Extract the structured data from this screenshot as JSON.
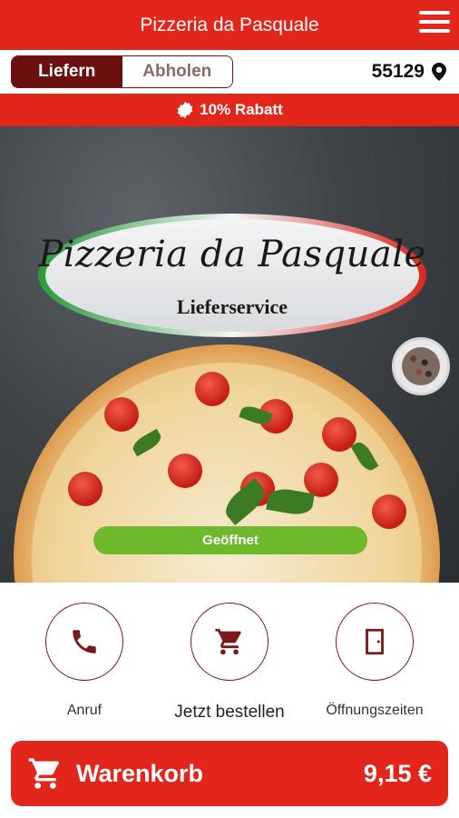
{
  "app": {
    "title": "Pizzeria da Pasquale"
  },
  "header": {
    "menu_icon": "hamburger-menu-icon"
  },
  "mode_toggle": {
    "options": [
      "Liefern",
      "Abholen"
    ],
    "selected": "Liefern"
  },
  "location": {
    "postal_code": "55129",
    "icon": "location-pin-icon"
  },
  "promo": {
    "text": "10% Rabatt",
    "icon": "badge-star-icon"
  },
  "hero": {
    "logo_name": "Pizzeria da Pasquale",
    "logo_subtitle": "Lieferservice",
    "status_label": "Geöffnet",
    "status_color": "#6fba2c"
  },
  "actions": [
    {
      "label": "Anruf",
      "icon": "phone-icon"
    },
    {
      "label": "Jetzt bestellen",
      "icon": "shopping-cart-icon"
    },
    {
      "label": "Öffnungszeiten",
      "icon": "door-icon"
    }
  ],
  "cart": {
    "label": "Warenkorb",
    "total": "9,15 €",
    "icon": "shopping-cart-icon"
  },
  "colors": {
    "brand_red": "#e3261c",
    "dark_red": "#6b0f0f",
    "open_green": "#6fba2c"
  }
}
